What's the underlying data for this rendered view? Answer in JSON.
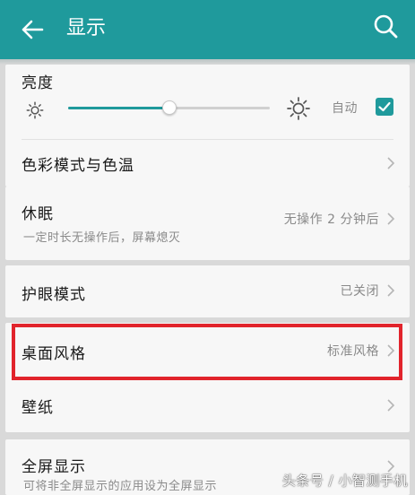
{
  "appbar": {
    "title": "显示",
    "back_icon": "arrow-left-icon",
    "search_icon": "search-icon",
    "color": "#1f9a9c"
  },
  "brightness": {
    "label": "亮度",
    "auto_label": "自动",
    "auto_checked": true,
    "level": 0.5
  },
  "items": [
    {
      "label": "色彩模式与色温",
      "value": "",
      "sublabel": ""
    },
    {
      "label": "休眠",
      "value": "无操作 2 分钟后",
      "sublabel": "一定时长无操作后，屏幕熄灭"
    },
    {
      "label": "护眼模式",
      "value": "已关闭",
      "sublabel": ""
    },
    {
      "label": "桌面风格",
      "value": "标准风格",
      "sublabel": ""
    },
    {
      "label": "壁纸",
      "value": "",
      "sublabel": ""
    },
    {
      "label": "全屏显示",
      "value": "",
      "sublabel": "可将非全屏显示的应用设为全屏显示"
    }
  ],
  "highlight_color": "#e1242c",
  "watermark": "头条号 / 小智测手机"
}
